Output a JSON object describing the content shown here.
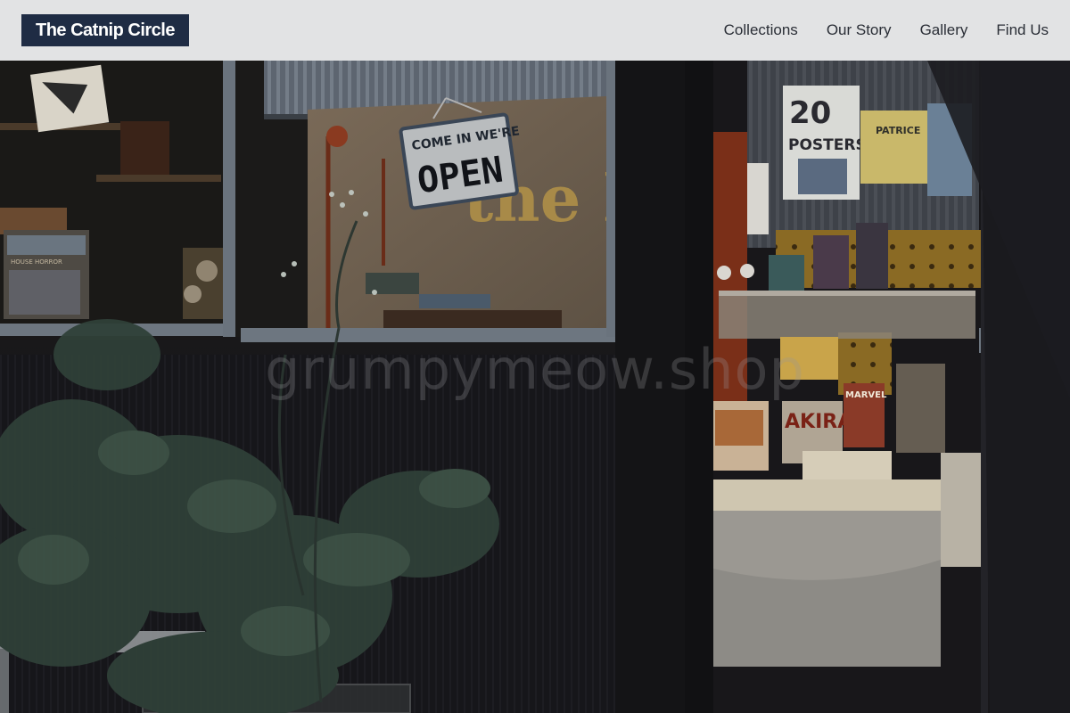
{
  "navbar": {
    "brand": "The Catnip Circle",
    "links": [
      {
        "label": "Collections"
      },
      {
        "label": "Our Story"
      },
      {
        "label": "Gallery"
      },
      {
        "label": "Find Us"
      }
    ]
  },
  "hero": {
    "watermark": "grumpymeow.shop",
    "scene": {
      "sign_line1": "COME IN WE'RE",
      "sign_line2": "OPEN",
      "storefront_letters": "the lezca",
      "poster_1": "20",
      "poster_1_sub": "POSTERS",
      "poster_2": "PATRICE",
      "book_1": "AKIRA",
      "book_2": "MARVEL",
      "book_3": "HOUSE HORROR"
    }
  },
  "colors": {
    "navbar_bg": "#e2e3e4",
    "brand_bg": "#1f2c44",
    "brand_text": "#ffffff",
    "nav_text": "#2a2e36"
  }
}
